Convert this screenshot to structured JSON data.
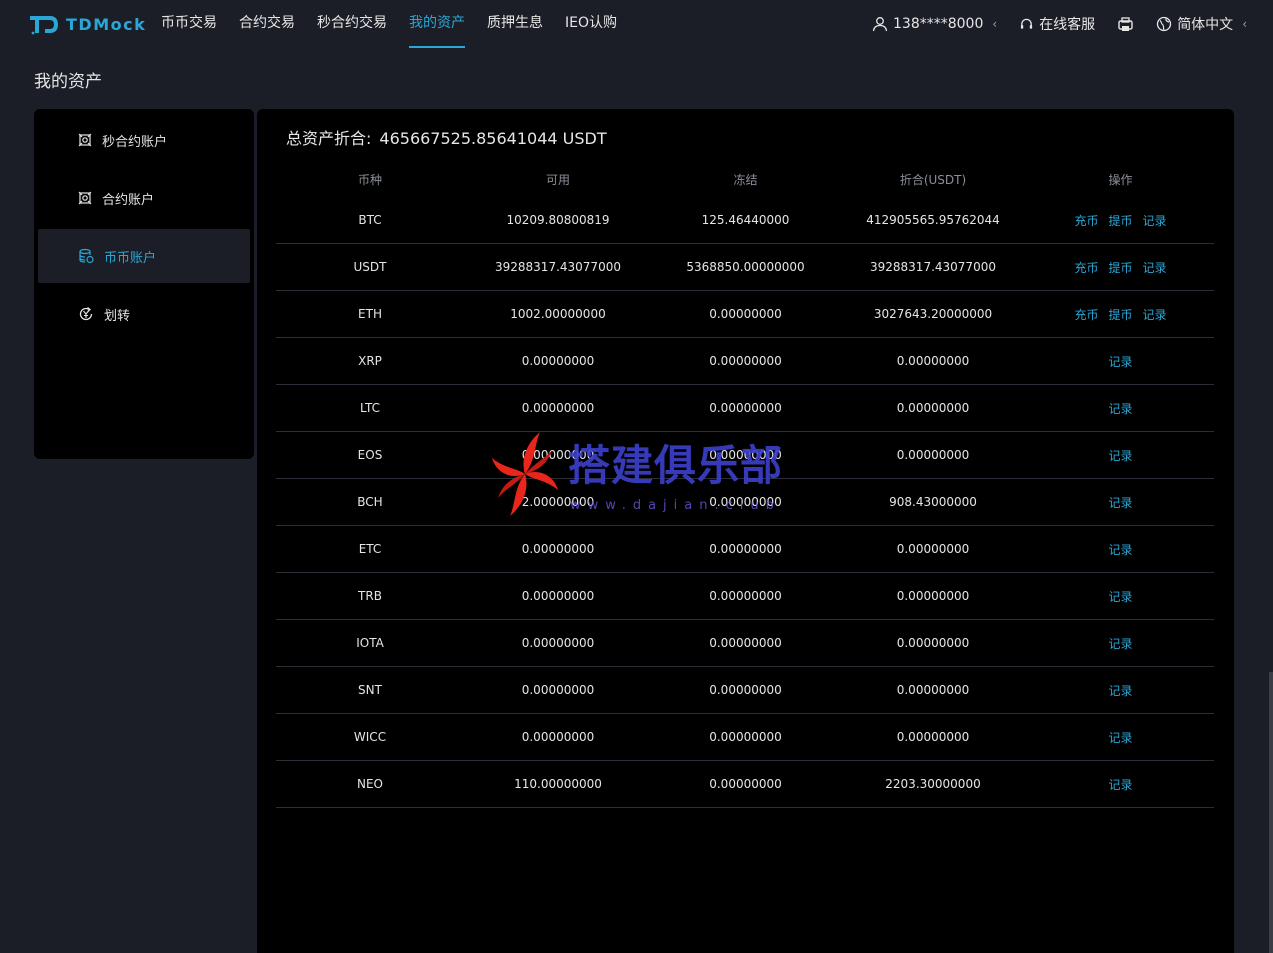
{
  "brand": {
    "name": "TDMock",
    "color": "#2aa7d6"
  },
  "nav": [
    {
      "label": "币币交易",
      "active": false
    },
    {
      "label": "合约交易",
      "active": false
    },
    {
      "label": "秒合约交易",
      "active": false
    },
    {
      "label": "我的资产",
      "active": true
    },
    {
      "label": "质押生息",
      "active": false
    },
    {
      "label": "IEO认购",
      "active": false
    }
  ],
  "header_right": {
    "user": "138****8000",
    "support": "在线客服",
    "language": "简体中文",
    "icons": [
      "user-icon",
      "headset-icon",
      "app-download-icon",
      "globe-icon"
    ]
  },
  "page_title": "我的资产",
  "sidebar": [
    {
      "label": "秒合约账户",
      "icon": "contract-icon",
      "active": false
    },
    {
      "label": "合约账户",
      "icon": "contract-icon",
      "active": false
    },
    {
      "label": "币币账户",
      "icon": "coins-icon",
      "active": true
    },
    {
      "label": "划转",
      "icon": "transfer-icon",
      "active": false
    }
  ],
  "total": {
    "label": "总资产折合:",
    "value": "465667525.85641044 USDT"
  },
  "table": {
    "headers": [
      "币种",
      "可用",
      "冻结",
      "折合(USDT)",
      "操作"
    ],
    "rows": [
      {
        "coin": "BTC",
        "available": "10209.80800819",
        "frozen": "125.46440000",
        "usdt": "412905565.95762044",
        "actions": [
          "充币",
          "提币",
          "记录"
        ]
      },
      {
        "coin": "USDT",
        "available": "39288317.43077000",
        "frozen": "5368850.00000000",
        "usdt": "39288317.43077000",
        "actions": [
          "充币",
          "提币",
          "记录"
        ]
      },
      {
        "coin": "ETH",
        "available": "1002.00000000",
        "frozen": "0.00000000",
        "usdt": "3027643.20000000",
        "actions": [
          "充币",
          "提币",
          "记录"
        ]
      },
      {
        "coin": "XRP",
        "available": "0.00000000",
        "frozen": "0.00000000",
        "usdt": "0.00000000",
        "actions": [
          "记录"
        ]
      },
      {
        "coin": "LTC",
        "available": "0.00000000",
        "frozen": "0.00000000",
        "usdt": "0.00000000",
        "actions": [
          "记录"
        ]
      },
      {
        "coin": "EOS",
        "available": "0.00000000",
        "frozen": "0.00000000",
        "usdt": "0.00000000",
        "actions": [
          "记录"
        ]
      },
      {
        "coin": "BCH",
        "available": "2.00000000",
        "frozen": "0.00000000",
        "usdt": "908.43000000",
        "actions": [
          "记录"
        ]
      },
      {
        "coin": "ETC",
        "available": "0.00000000",
        "frozen": "0.00000000",
        "usdt": "0.00000000",
        "actions": [
          "记录"
        ]
      },
      {
        "coin": "TRB",
        "available": "0.00000000",
        "frozen": "0.00000000",
        "usdt": "0.00000000",
        "actions": [
          "记录"
        ]
      },
      {
        "coin": "IOTA",
        "available": "0.00000000",
        "frozen": "0.00000000",
        "usdt": "0.00000000",
        "actions": [
          "记录"
        ]
      },
      {
        "coin": "SNT",
        "available": "0.00000000",
        "frozen": "0.00000000",
        "usdt": "0.00000000",
        "actions": [
          "记录"
        ]
      },
      {
        "coin": "WICC",
        "available": "0.00000000",
        "frozen": "0.00000000",
        "usdt": "0.00000000",
        "actions": [
          "记录"
        ]
      },
      {
        "coin": "NEO",
        "available": "110.00000000",
        "frozen": "0.00000000",
        "usdt": "2203.30000000",
        "actions": [
          "记录"
        ]
      }
    ]
  },
  "watermark": {
    "text": "搭建俱乐部",
    "url": "www.dajian.club"
  }
}
